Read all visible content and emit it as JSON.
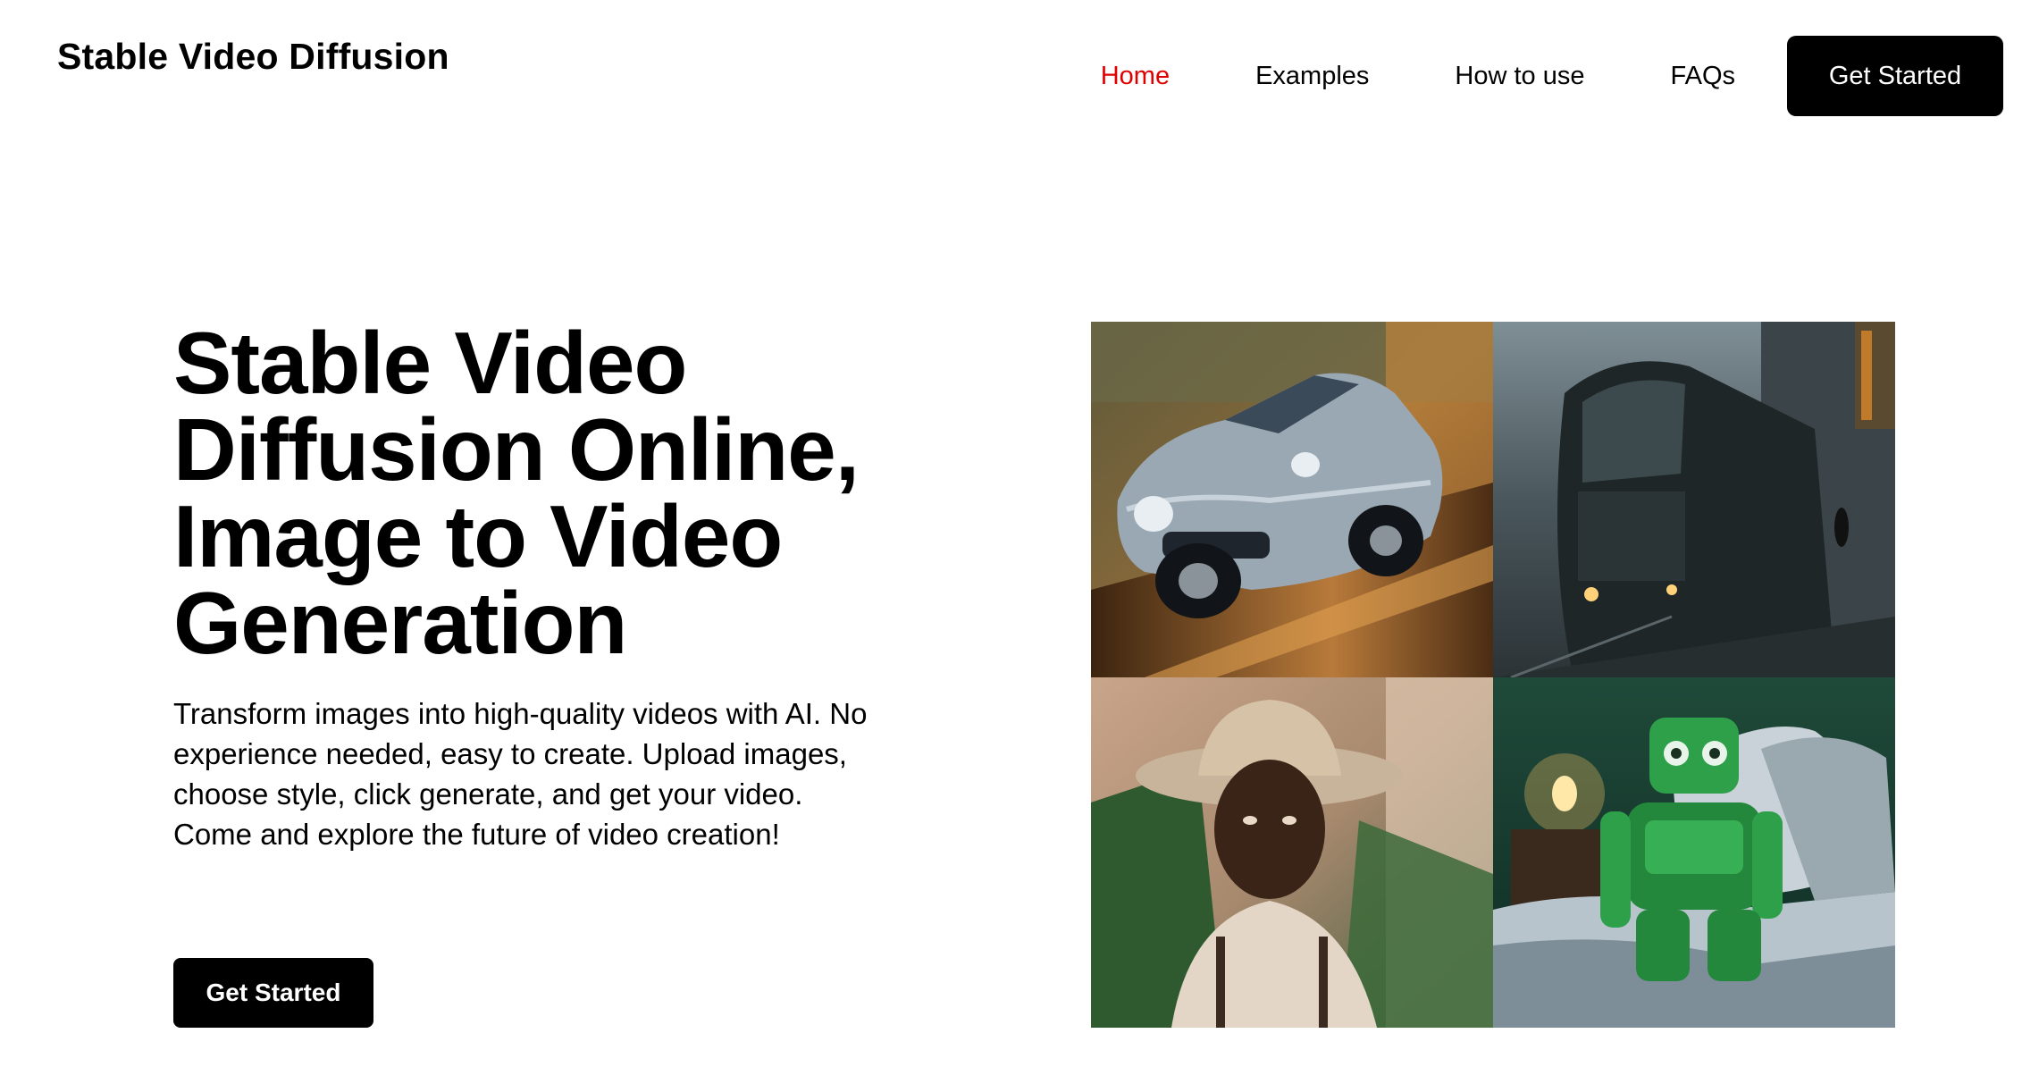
{
  "header": {
    "logo": "Stable Video Diffusion",
    "nav": [
      "Home",
      "Examples",
      "How to use",
      "FAQs"
    ],
    "cta_label": "Get Started"
  },
  "hero": {
    "title_lines": [
      "Stable Video",
      "Diffusion Online,",
      "Image to Video",
      "Generation"
    ],
    "description": "Transform images into high-quality videos with AI. No experience needed, easy to create. Upload images, choose style, click generate, and get your video. Come and explore the future of video creation!",
    "cta_label": "Get Started"
  },
  "colors": {
    "accent_active": "#e00000",
    "button_bg": "#000000",
    "button_text": "#ffffff"
  },
  "gallery": {
    "images": [
      "vintage-car-image",
      "train-in-rain-image",
      "cowboy-portrait-image",
      "green-robot-in-bed-image"
    ]
  }
}
